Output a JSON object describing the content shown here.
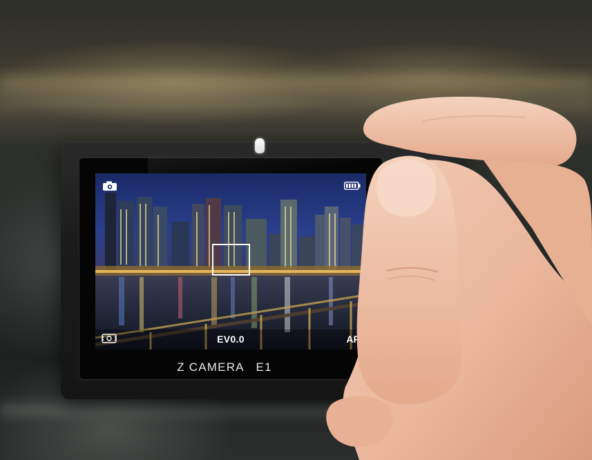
{
  "viewfinder": {
    "icons": {
      "mode": "camera-icon",
      "battery": "battery-icon",
      "stabilizer": "image-stabilization-icon"
    },
    "exposure": "EV0.0",
    "focus_mode": "AF"
  },
  "camera": {
    "model_label": "Z CAMERA   E1"
  },
  "colors": {
    "overlay_text": "#ffffff",
    "focus_frame": "#ffffff",
    "body": "#1b1b1b"
  }
}
